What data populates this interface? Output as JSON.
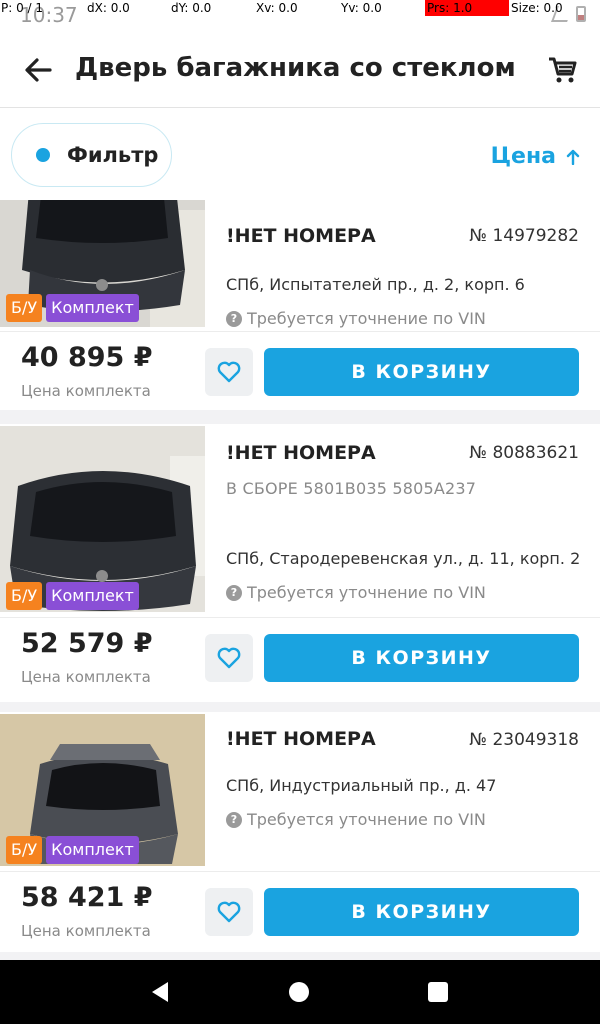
{
  "status_bar": {
    "time": "10:37"
  },
  "debug_overlay": {
    "p": "P: 0 / 1",
    "dx": "dX: 0.0",
    "dy": "dY: 0.0",
    "xv": "Xv: 0.0",
    "yv": "Yv: 0.0",
    "prs": "Prs: 1.0",
    "size": "Size: 0.0"
  },
  "app_bar": {
    "title": "Дверь багажника со стеклом",
    "back_icon": "arrow-left-icon",
    "cart_icon": "cart-icon"
  },
  "filter_bar": {
    "filter_label": "Фильтр",
    "sort_label": "Цена",
    "sort_icon": "arrow-up-icon",
    "accent_color": "#1aa3e0"
  },
  "products": [
    {
      "maker": "!НЕТ НОМЕРА",
      "number": "№ 14979282",
      "assembly": "",
      "address": "СПб, Испытателей пр., д. 2, корп. 6",
      "vin_note": "Требуется уточнение по VIN",
      "badge_condition": "Б/У",
      "badge_kit": "Комплект",
      "price": "40 895 ₽",
      "price_caption": "Цена комплекта",
      "cart_button": "В КОРЗИНУ"
    },
    {
      "maker": "!НЕТ НОМЕРА",
      "number": "№ 80883621",
      "assembly": "В СБОРЕ 5801B035 5805A237",
      "address": "СПб, Стародеревенская ул., д. 11, корп. 2",
      "vin_note": "Требуется уточнение по VIN",
      "badge_condition": "Б/У",
      "badge_kit": "Комплект",
      "price": "52 579 ₽",
      "price_caption": "Цена комплекта",
      "cart_button": "В КОРЗИНУ"
    },
    {
      "maker": "!НЕТ НОМЕРА",
      "number": "№ 23049318",
      "assembly": "",
      "address": "СПб, Индустриальный пр., д. 47",
      "vin_note": "Требуется уточнение по VIN",
      "badge_condition": "Б/У",
      "badge_kit": "Комплект",
      "price": "58 421 ₽",
      "price_caption": "Цена комплекта",
      "cart_button": "В КОРЗИНУ"
    }
  ],
  "colors": {
    "accent": "#1aa3e0",
    "badge_used": "#f5821f",
    "badge_kit": "#8a4fd6"
  }
}
